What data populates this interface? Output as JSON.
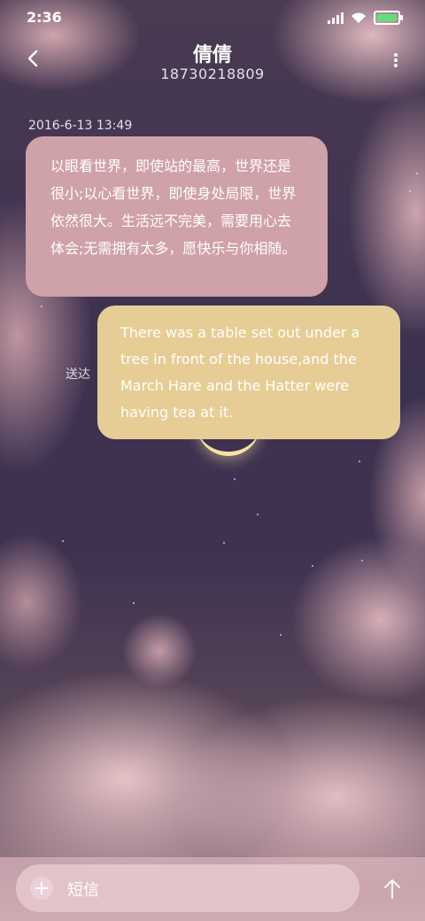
{
  "status_bar": {
    "time": "2:36"
  },
  "header": {
    "contact_name": "倩倩",
    "phone_number": "18730218809",
    "back_icon": "chevron-left-icon",
    "more_icon": "more-vertical-icon"
  },
  "conversation": {
    "timestamp": "2016-6-13 13:49",
    "incoming_message": "以眼看世界，即使站的最高，世界还是很小;以心看世界，即使身处局限，世界依然很大。生活远不完美，需要用心去体会;无需拥有太多，愿快乐与你相随。",
    "outgoing_message": "There was a table set out under a tree in front of the house,and the March Hare and the Hatter were having tea at it.",
    "outgoing_status": "送达"
  },
  "composer": {
    "placeholder": "短信",
    "add_icon": "plus-icon",
    "send_icon": "arrow-up-icon"
  },
  "colors": {
    "incoming_bubble": "#cfa1a8",
    "outgoing_bubble": "#e6cd95",
    "battery_charging": "#5fe07a"
  }
}
